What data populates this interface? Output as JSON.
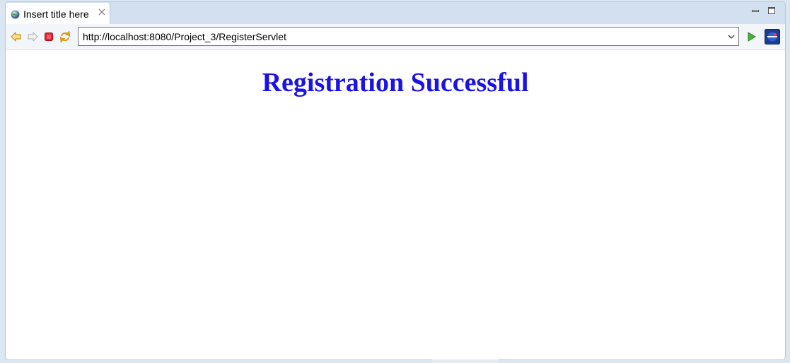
{
  "tab": {
    "title": "Insert title here",
    "icon": "globe-icon",
    "close_icon": "close-icon"
  },
  "window_controls": {
    "minimize_icon": "minimize-icon",
    "maximize_icon": "maximize-icon"
  },
  "toolbar": {
    "back_icon": "back-arrow-icon",
    "forward_icon": "forward-arrow-icon",
    "stop_icon": "stop-icon",
    "refresh_icon": "refresh-icon",
    "url": "http://localhost:8080/Project_3/RegisterServlet",
    "dropdown_icon": "chevron-down-icon",
    "go_icon": "go-play-icon",
    "browser_icon": "eclipse-browser-icon"
  },
  "content": {
    "heading": "Registration Successful",
    "heading_color": "#1a12e8"
  },
  "colors": {
    "chrome_background": "#d3e0ef",
    "toolbar_background": "#f2f5f9",
    "page_background": "#ffffff"
  }
}
